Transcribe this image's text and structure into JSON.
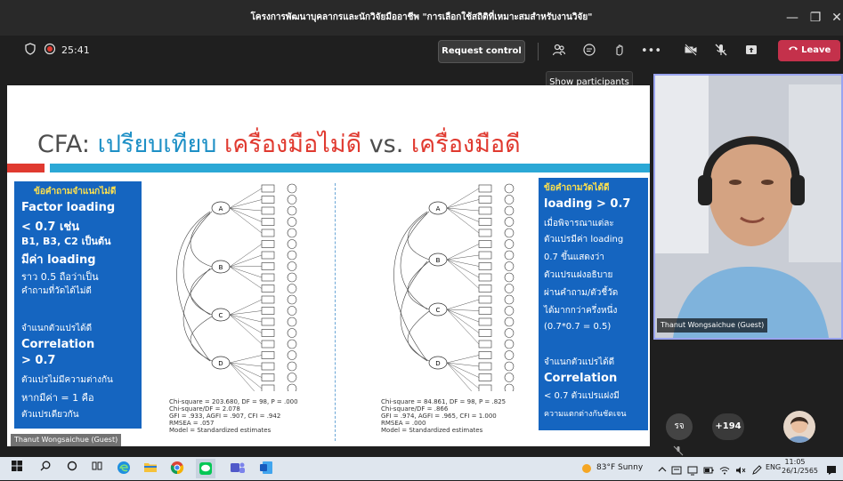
{
  "window": {
    "title": "โครงการพัฒนาบุคลากรและนักวิจัยมืออาชีพ \"การเลือกใช้สถิติที่เหมาะสมสำหรับงานวิจัย\"",
    "minimize": "—",
    "maximize": "❐",
    "close": "✕"
  },
  "toolbar": {
    "timer": "25:41",
    "request_control": "Request control",
    "leave": "Leave",
    "more": "•••",
    "tooltip": "Show participants"
  },
  "slide": {
    "title_prefix": "CFA: ",
    "title_compare": "เปรียบเทียบ ",
    "title_bad": "เครื่องมือไม่ดี",
    "title_vs": " vs. ",
    "title_good": "เครื่องมือดี",
    "left_box": {
      "l1": "ข้อคำถามจำแนกไม่ดี",
      "l2": "Factor loading",
      "l3": "< 0.7 เช่น",
      "l4": "B1, B3, C2 เป็นต้น",
      "l5": "มีค่า loading",
      "l6": "ราว 0.5 ถือว่าเป็น",
      "l7": "คำถามที่วัดได้ไม่ดี",
      "l8": "จำแนกตัวแปรได้ดี",
      "l9": "Correlation",
      "l10": "> 0.7",
      "l11": "ตัวแปรไม่มีความต่างกัน",
      "l12": "หากมีค่า = 1 คือ",
      "l13": "ตัวแปรเดียวกัน"
    },
    "right_box": {
      "l1": "ข้อคำถามวัดได้ดี",
      "l2": "loading > 0.7",
      "l3": "เมื่อพิจารณาแต่ละ",
      "l4": "ตัวแปรมีค่า loading",
      "l5": "0.7 ขึ้นแสดงว่า",
      "l6": "ตัวแปรแฝงอธิบาย",
      "l7": "ผ่านคำถาม/ตัวชี้วัด",
      "l8": "ได้มากกว่าครึ่งหนึ่ง",
      "l9": "(0.7*0.7 = 0.5)",
      "l10": "จำแนกตัวแปรได้ดี",
      "l11": "Correlation",
      "l12": "< 0.7 ตัวแปรแฝงมี",
      "l13": "ความแตกต่างกันชัดเจน"
    },
    "stats_left": [
      "Chi-square = 203.680, DF = 98, P = .000",
      "Chi-square/DF = 2.078",
      "GFI = .933, AGFI = .907, CFI = .942",
      "RMSEA = .057",
      "Model = Standardized estimates"
    ],
    "stats_right": [
      "Chi-square = 84.861, DF = 98, P = .825",
      "Chi-square/DF = .866",
      "GFI = .974, AGFI = .965, CFI = 1.000",
      "RMSEA = .000",
      "Model = Standardized estimates"
    ],
    "factors_left": [
      "A",
      "B",
      "C",
      "D"
    ],
    "factors_right": [
      "A",
      "B",
      "C",
      "D"
    ],
    "presenter_label": "Thanut Wongsaichue (Guest)"
  },
  "camera": {
    "name": "Thanut Wongsaichue (Guest)"
  },
  "participants": {
    "initials": "รจ",
    "more_count": "+194"
  },
  "taskbar": {
    "weather": "83°F  Sunny",
    "lang": "ENG",
    "time": "11:05",
    "date": "26/1/2565"
  },
  "colors": {
    "accent_blue": "#1565c0",
    "slide_title_blue": "#1e90c6",
    "slide_title_red": "#e03a30",
    "leave_red": "#c4314b"
  }
}
